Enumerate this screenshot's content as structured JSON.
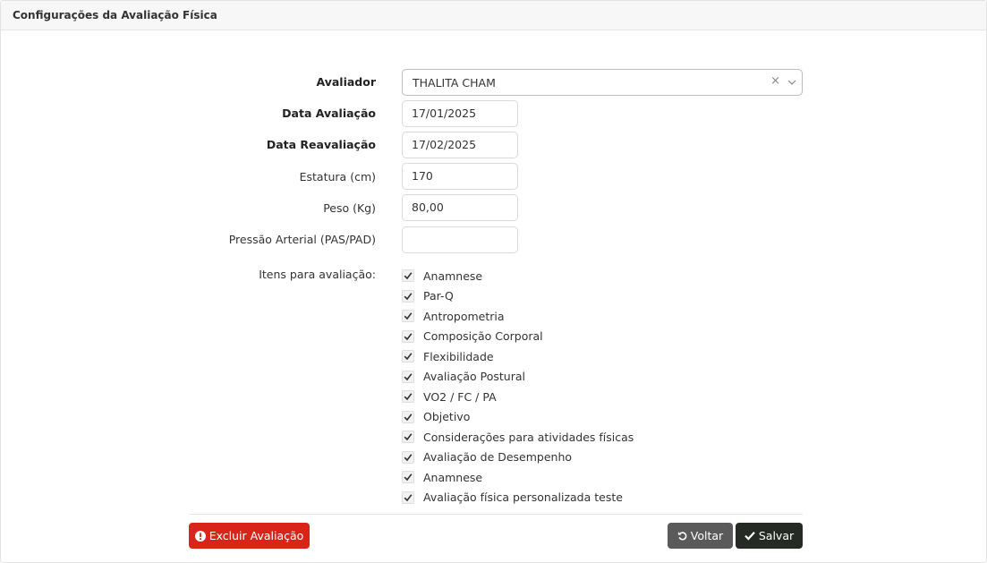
{
  "panel": {
    "title": "Configurações da Avaliação Física"
  },
  "form": {
    "avaliador": {
      "label": "Avaliador",
      "value": "THALITA CHAM",
      "clear": "×"
    },
    "data_avaliacao": {
      "label": "Data Avaliação",
      "value": "17/01/2025"
    },
    "data_reavaliacao": {
      "label": "Data Reavaliação",
      "value": "17/02/2025"
    },
    "estatura": {
      "label": "Estatura (cm)",
      "value": "170"
    },
    "peso": {
      "label": "Peso (Kg)",
      "value": "80,00"
    },
    "pressao": {
      "label": "Pressão Arterial (PAS/PAD)",
      "value": ""
    },
    "itens_label": "Itens para avaliação:",
    "itens": [
      {
        "label": "Anamnese",
        "checked": true
      },
      {
        "label": "Par-Q",
        "checked": true
      },
      {
        "label": "Antropometria",
        "checked": true
      },
      {
        "label": "Composição Corporal",
        "checked": true
      },
      {
        "label": "Flexibilidade",
        "checked": true
      },
      {
        "label": "Avaliação Postural",
        "checked": true
      },
      {
        "label": "VO2 / FC / PA",
        "checked": true
      },
      {
        "label": "Objetivo",
        "checked": true
      },
      {
        "label": "Considerações para atividades físicas",
        "checked": true
      },
      {
        "label": "Avaliação de Desempenho",
        "checked": true
      },
      {
        "label": "Anamnese",
        "checked": true
      },
      {
        "label": "Avaliação física personalizada teste",
        "checked": true
      }
    ]
  },
  "actions": {
    "delete_label": "Excluir Avaliação",
    "back_label": "Voltar",
    "save_label": "Salvar"
  },
  "colors": {
    "delete": "#d9241a",
    "back": "#5a5a5a",
    "save": "#262a24"
  }
}
